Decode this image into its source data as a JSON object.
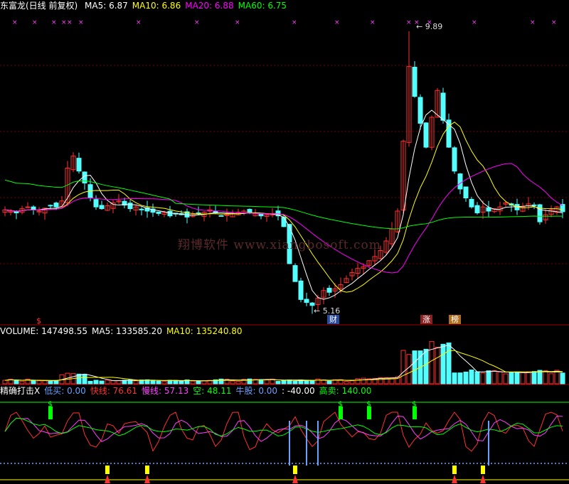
{
  "price_panel": {
    "title": "东富龙(日线 前复权)",
    "ma_legend": [
      {
        "label": "MA5: 6.87",
        "color": "#ffffff"
      },
      {
        "label": "MA10: 6.86",
        "color": "#ffff00"
      },
      {
        "label": "MA20: 6.88",
        "color": "#ff00ff"
      },
      {
        "label": "MA60: 6.75",
        "color": "#00ff00"
      }
    ],
    "high_label": "9.89",
    "low_label": "5.16",
    "markers": {
      "dollar": "$",
      "cai": "财",
      "zhang": "涨",
      "bang": "榜"
    },
    "watermark": "翔博软件 www.xiangbosoft.com"
  },
  "volume_panel": {
    "legend": [
      {
        "label": "VOLUME: 147498.55",
        "color": "#ffffff"
      },
      {
        "label": "MA5: 133585.20",
        "color": "#ffffff"
      },
      {
        "label": "MA10: 135240.80",
        "color": "#ffff00"
      }
    ]
  },
  "indicator_panel": {
    "legend": [
      {
        "label": "精确打击X",
        "color": "#ffffff"
      },
      {
        "label": "低买: 0.00",
        "color": "#6aa0ff"
      },
      {
        "label": "快线: 76.61",
        "color": "#ff3030"
      },
      {
        "label": "慢线: 57.13",
        "color": "#ff40ff"
      },
      {
        "label": "空: 48.11",
        "color": "#00ff00"
      },
      {
        "label": "牛股: 0.00",
        "color": "#6aa0ff"
      },
      {
        "label": ": -40.00",
        "color": "#ffffff"
      },
      {
        "label": "高卖: 140.00",
        "color": "#00ff00"
      }
    ]
  },
  "chart_data": {
    "type": "candlestick",
    "title": "东富龙(日线 前复权)",
    "ohlc_points": 99,
    "price_range_shown": [
      5.16,
      9.89
    ],
    "moving_averages": {
      "MA5": 6.87,
      "MA10": 6.86,
      "MA20": 6.88,
      "MA60": 6.75
    },
    "closes": [
      6.9,
      6.88,
      6.85,
      6.92,
      6.95,
      6.9,
      6.88,
      6.93,
      6.97,
      6.95,
      7.05,
      7.6,
      7.8,
      7.55,
      7.35,
      7.1,
      6.95,
      6.92,
      6.97,
      7.02,
      7.05,
      6.98,
      6.92,
      6.95,
      6.9,
      6.88,
      6.86,
      6.84,
      6.86,
      6.8,
      6.83,
      6.82,
      6.78,
      6.82,
      6.84,
      6.86,
      6.9,
      6.85,
      6.8,
      6.82,
      6.84,
      6.86,
      6.88,
      6.85,
      6.84,
      6.8,
      6.82,
      6.84,
      6.8,
      6.62,
      6.0,
      5.7,
      5.4,
      5.35,
      5.3,
      5.42,
      5.55,
      5.52,
      5.58,
      5.65,
      5.75,
      5.85,
      5.92,
      5.95,
      6.05,
      6.12,
      6.22,
      6.38,
      6.58,
      6.88,
      8.05,
      9.3,
      8.8,
      8.35,
      7.95,
      8.45,
      8.9,
      8.4,
      7.95,
      7.55,
      7.25,
      7.1,
      6.95,
      6.85,
      6.95,
      6.88,
      6.92,
      6.95,
      7.02,
      6.98,
      6.9,
      6.95,
      7.0,
      6.98,
      6.7,
      6.82,
      6.9,
      6.95,
      6.87
    ],
    "volume": {
      "VOLUME": 147498.55,
      "MA5": 133585.2,
      "MA10": 135240.8
    },
    "indicator": {
      "name": "精确打击X",
      "低买": 0.0,
      "快线": 76.61,
      "慢线": 57.13,
      "空": 48.11,
      "牛股": 0.0,
      "level": -40.0,
      "高卖": 140.0
    }
  }
}
